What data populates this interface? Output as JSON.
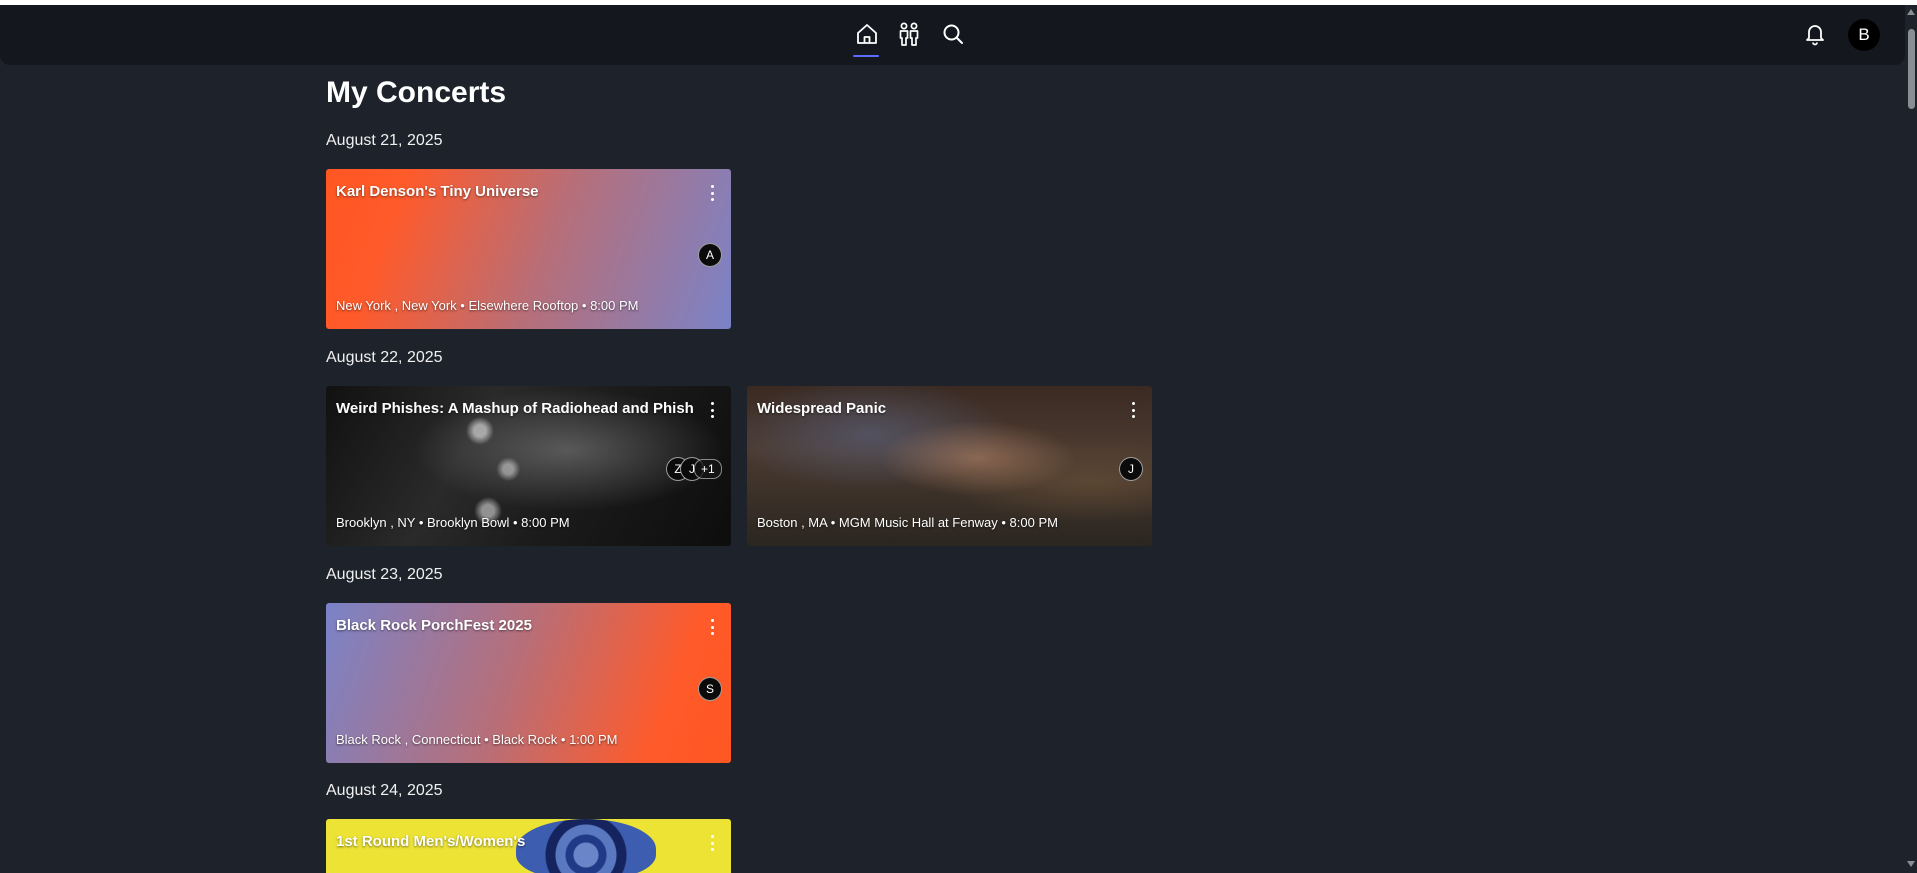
{
  "nav": {
    "home_icon": "home-icon",
    "friends_icon": "friends-icon",
    "search_icon": "search-icon",
    "bell_icon": "bell-icon",
    "user_initial": "B"
  },
  "page": {
    "title": "My Concerts"
  },
  "groups": [
    {
      "date": "August 21, 2025",
      "cards": [
        {
          "title": "Karl Denson's Tiny Universe",
          "meta": "New York , New York • Elsewhere Rooftop • 8:00 PM",
          "attendees": [
            "A"
          ]
        }
      ]
    },
    {
      "date": "August 22, 2025",
      "cards": [
        {
          "title": "Weird Phishes: A Mashup of Radiohead and Phish",
          "meta": "Brooklyn , NY • Brooklyn Bowl • 8:00 PM",
          "attendees": [
            "Z",
            "J"
          ],
          "extra": "+1"
        },
        {
          "title": "Widespread Panic",
          "meta": "Boston , MA • MGM Music Hall at Fenway • 8:00 PM",
          "attendees": [
            "J"
          ]
        }
      ]
    },
    {
      "date": "August 23, 2025",
      "cards": [
        {
          "title": "Black Rock PorchFest 2025",
          "meta": "Black Rock , Connecticut • Black Rock • 1:00 PM",
          "attendees": [
            "S"
          ]
        }
      ]
    },
    {
      "date": "August 24, 2025",
      "cards": [
        {
          "title": "1st Round Men's/Women's"
        }
      ]
    }
  ],
  "colors": {
    "background": "#1e232b",
    "navbar": "#14181e",
    "accent": "#5b6bff"
  }
}
